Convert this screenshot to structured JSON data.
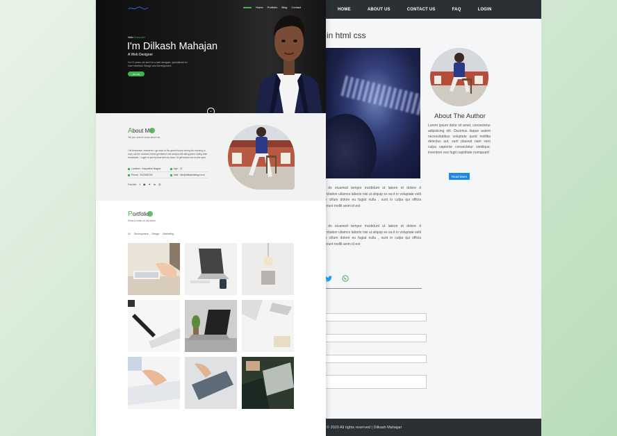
{
  "blog": {
    "nav": [
      "HOME",
      "ABOUT US",
      "CONTACT US",
      "FAQ",
      "LOGIN"
    ],
    "title": "e in html css",
    "para1": "sed do eiusmod tempor incididunt ut labore et dolore d exercitation ullamco laboris nisi ut aliquip ex ea it in voluptate velit esse cillum dolore eu fugiat nulla , sunt in culpa qui officia deserunt mollit anim id est",
    "para2": "sed do eiusmod tempor incididunt ut labore et dolore d exercitation ullamco laboris nisi ut aliquip ex ea it in voluptate velit esse cillum dolore eu fugiat nulla , sunt in culpa qui officia deserunt mollit anim id est",
    "author_title": "About The Author",
    "author_text": "Lorem ipsum dolor sit amet, consectetur adipisicing elit. Ducimus itaque autem necessitatibus voluptate quod mollitia delectus aut, sunt placeat nam vero culpa sapiente consectetur similique, inventore eos fugit cupiditate numquam!",
    "read_more": "Read More",
    "footer": "© 2020 All rights reserved | Dilkash Mahajan"
  },
  "portfolio_site": {
    "nav": [
      "Home",
      "Portfolio",
      "Blog",
      "Contact"
    ],
    "hello": "Hello",
    "hello_accent": "Everyone!",
    "name": "I'm Dilkash Mahajan",
    "role": "A Web Designer",
    "desc": "I'm 21 years old and I'm a web designer, specialized for User Interface Design and Development.",
    "hire": "Hire Me",
    "about_title_first": "A",
    "about_title_rest": "bout Me",
    "about_sub": "Tell you need to know about me.",
    "about_text": "I hit lemonade, whenever I go back to the grand house during the morning to copy out the contract, these gentlemen are always still sitting there eating their breakfasts. I ought to just try that with my boss; I'd get kicked out on the spot.",
    "location_label": "Location:",
    "location": "Kasyudhai Nagpur",
    "age_label": "Age:",
    "age": "21",
    "phone_label": "Phone:",
    "phone": "9123456781",
    "mail_label": "Mail:",
    "mail": "info@dilkashdesign.com",
    "follow": "Find Me:",
    "portfolio_title_first": "P",
    "portfolio_title_rest": "ortfolio",
    "portfolio_sub": "Show & make on my works",
    "filters": [
      "All",
      "Development",
      "Design",
      "Marketing"
    ]
  },
  "colors": {
    "accent": "#3fb34f",
    "nav_dark": "#2b3035",
    "button_blue": "#1e88e5"
  }
}
